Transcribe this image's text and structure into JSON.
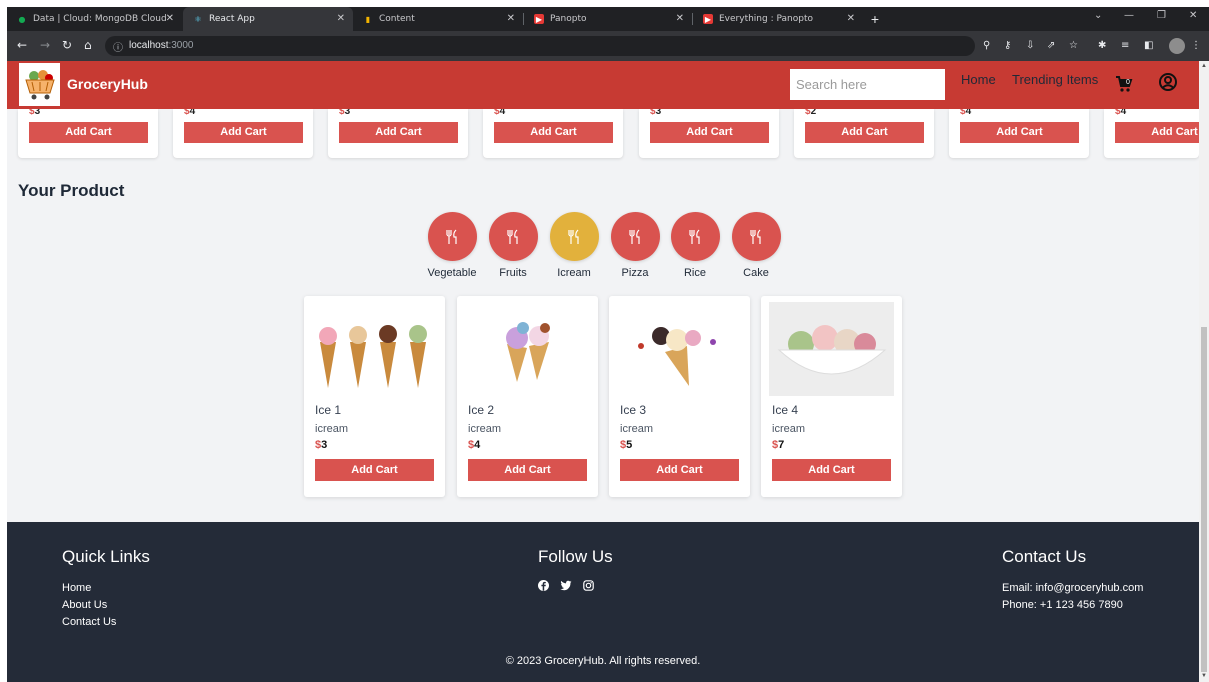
{
  "browser": {
    "tabs": [
      {
        "title": "Data | Cloud: MongoDB Cloud",
        "icon": "mongodb-leaf-icon",
        "active": false
      },
      {
        "title": "React App",
        "icon": "react-icon",
        "active": true
      },
      {
        "title": "Content",
        "icon": "bar-chart-icon",
        "active": false
      },
      {
        "title": "Panopto",
        "icon": "panopto-icon",
        "active": false
      },
      {
        "title": "Everything : Panopto",
        "icon": "panopto-icon",
        "active": false
      }
    ],
    "url_host": "localhost",
    "url_port": ":3000"
  },
  "header": {
    "brand": "GroceryHub",
    "search_placeholder": "Search here",
    "nav": [
      "Home",
      "Trending Items"
    ],
    "cart_count": "0",
    "brand_color": "#c73a33"
  },
  "strip": {
    "items": [
      {
        "price": "3",
        "button": "Add Cart"
      },
      {
        "price": "4",
        "button": "Add Cart"
      },
      {
        "price": "3",
        "button": "Add Cart"
      },
      {
        "price": "4",
        "button": "Add Cart"
      },
      {
        "price": "3",
        "button": "Add Cart"
      },
      {
        "price": "2",
        "button": "Add Cart"
      },
      {
        "price": "4",
        "button": "Add Cart"
      },
      {
        "price": "4",
        "button": "Add Cart"
      }
    ]
  },
  "section": {
    "title": "Your Product"
  },
  "categories": [
    {
      "label": "Vegetable",
      "active": false
    },
    {
      "label": "Fruits",
      "active": false
    },
    {
      "label": "Icream",
      "active": true
    },
    {
      "label": "Pizza",
      "active": false
    },
    {
      "label": "Rice",
      "active": false
    },
    {
      "label": "Cake",
      "active": false
    }
  ],
  "products": [
    {
      "name": "Ice 1",
      "category": "icream",
      "currency": "$",
      "price": "3",
      "button": "Add Cart"
    },
    {
      "name": "Ice 2",
      "category": "icream",
      "currency": "$",
      "price": "4",
      "button": "Add Cart"
    },
    {
      "name": "Ice 3",
      "category": "icream",
      "currency": "$",
      "price": "5",
      "button": "Add Cart"
    },
    {
      "name": "Ice 4",
      "category": "icream",
      "currency": "$",
      "price": "7",
      "button": "Add Cart"
    }
  ],
  "footer": {
    "quick_links_title": "Quick Links",
    "quick_links": [
      "Home",
      "About Us",
      "Contact Us"
    ],
    "follow_title": "Follow Us",
    "social_icons": [
      "facebook-icon",
      "twitter-icon",
      "instagram-icon"
    ],
    "contact_title": "Contact Us",
    "email": "Email: info@groceryhub.com",
    "phone": "Phone: +1 123 456 7890",
    "copyright": "© 2023 GroceryHub. All rights reserved."
  },
  "colors": {
    "accent_red": "#d9534f",
    "active_category": "#e2b13c",
    "footer_bg": "#242b38"
  }
}
